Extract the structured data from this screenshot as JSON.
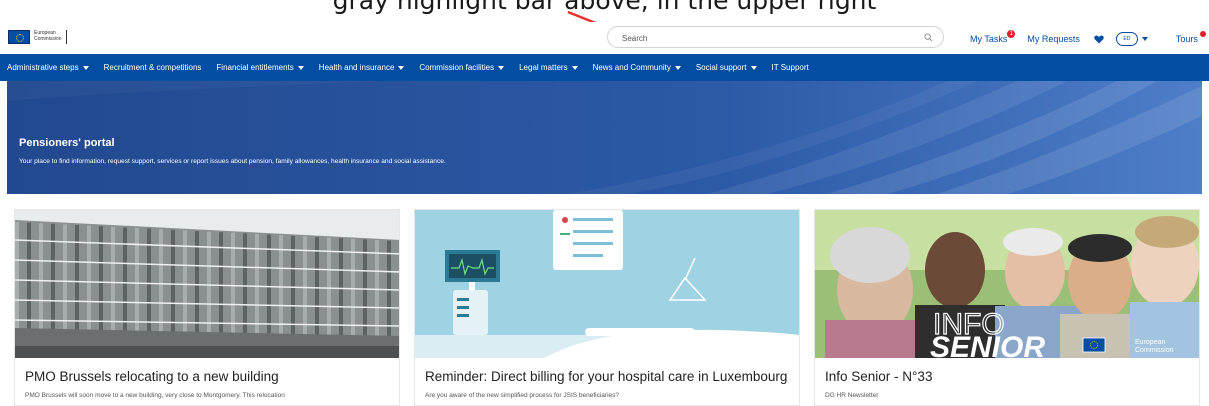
{
  "caption": "gray highlight bar above, in the upper right",
  "header": {
    "logo_line1": "European",
    "logo_line2": "Commission",
    "search_placeholder": "Search",
    "my_tasks": "My Tasks",
    "my_tasks_badge": "1",
    "my_requests": "My Requests",
    "lang": "ED",
    "tours": "Tours"
  },
  "nav": {
    "items": [
      {
        "label": "Administrative steps",
        "dropdown": true
      },
      {
        "label": "Recruitment & competitions",
        "dropdown": false
      },
      {
        "label": "Financial entitlements",
        "dropdown": true
      },
      {
        "label": "Health and insurance",
        "dropdown": true
      },
      {
        "label": "Commission facilities",
        "dropdown": true
      },
      {
        "label": "Legal matters",
        "dropdown": true
      },
      {
        "label": "News and Community",
        "dropdown": true
      },
      {
        "label": "Social support",
        "dropdown": true
      },
      {
        "label": "IT Support",
        "dropdown": false
      }
    ]
  },
  "hero": {
    "title": "Pensioners' portal",
    "subtitle": "Your place to find information, request support, services or report issues about pension, family allowances, health insurance and social assistance."
  },
  "cards": [
    {
      "title": "PMO Brussels relocating to a new building",
      "desc": "PMO Brussels will soon move to a new building, very close to Montgomery. This relocation"
    },
    {
      "title": "Reminder: Direct billing for your hospital care in Luxembourg",
      "desc": "Are you aware of the new simplified process for JSIS beneficiaries?"
    },
    {
      "title": "Info Senior - N°33",
      "desc": "DG HR Newsletter",
      "img_text_1": "INFO",
      "img_text_2": "SENIOR",
      "img_logo_1": "European",
      "img_logo_2": "Commission"
    }
  ],
  "colors": {
    "brand_blue": "#034ea2",
    "hero_blue": "#1f4591",
    "badge_red": "#e0202e"
  }
}
